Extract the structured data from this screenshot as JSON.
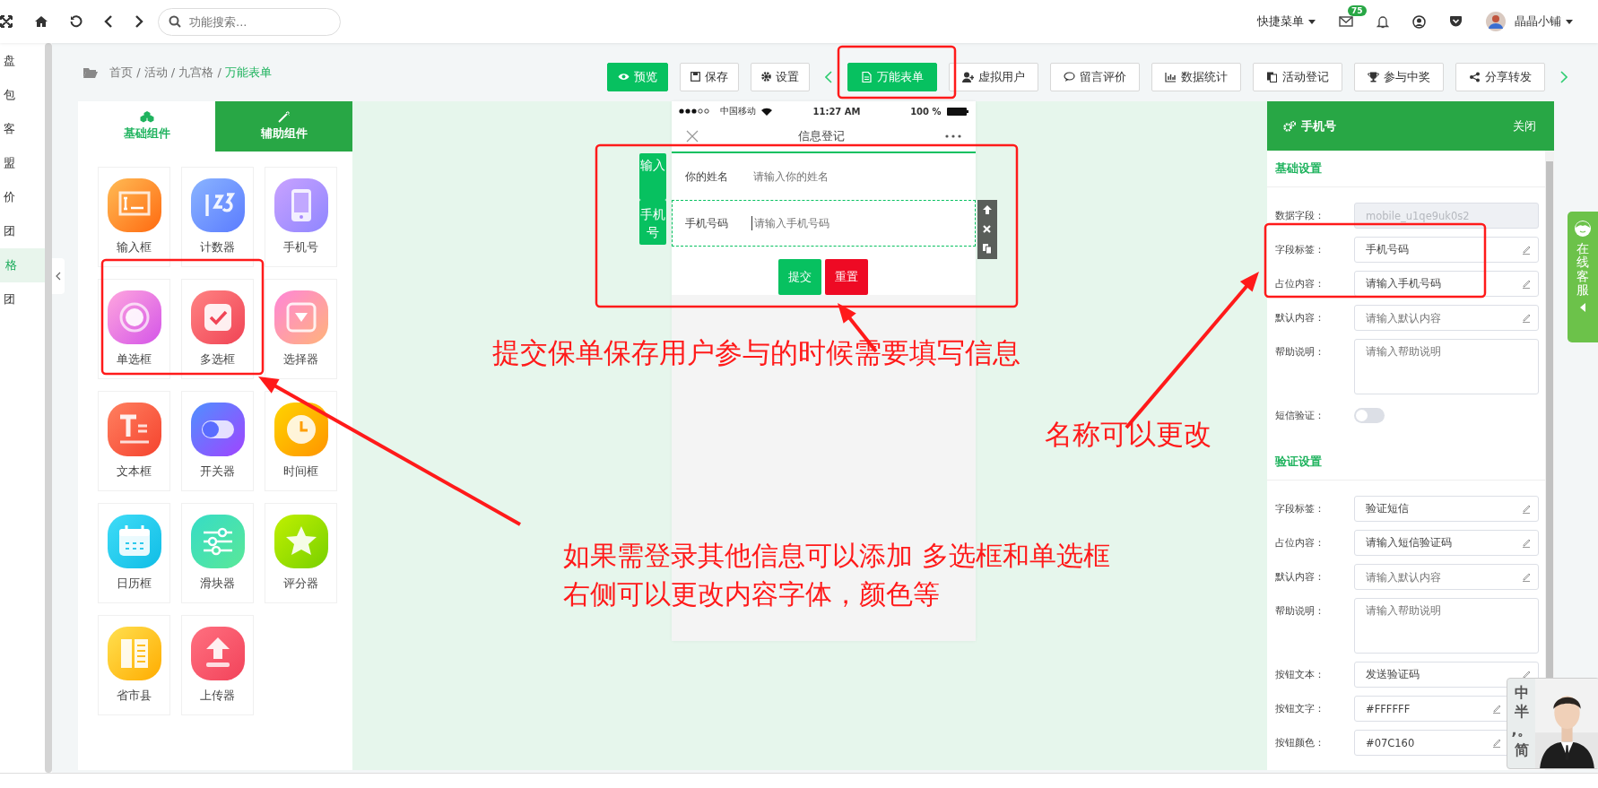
{
  "top_bar": {
    "search": {
      "placeholder": "功能搜索..."
    },
    "quick_menu": "快捷菜单",
    "mail_badge": "75",
    "user_name": "晶晶小铺"
  },
  "sidebar": {
    "items": [
      {
        "label": "盘",
        "selected": false
      },
      {
        "label": "包",
        "selected": false
      },
      {
        "label": "客",
        "selected": false
      },
      {
        "label": "盟",
        "selected": false
      },
      {
        "label": "价",
        "selected": false
      },
      {
        "label": "团",
        "selected": false
      },
      {
        "label": "格",
        "selected": true
      },
      {
        "label": "团",
        "selected": false
      }
    ]
  },
  "breadcrumb": {
    "path": "首页 / 活动 / 九宫格 /",
    "current": "万能表单"
  },
  "toolbar": {
    "preview": "预览",
    "actions": [
      {
        "label": "保存",
        "kind": "save"
      },
      {
        "label": "设置",
        "kind": "settings"
      }
    ],
    "tabs": [
      {
        "label": "万能表单",
        "kind": "form",
        "selected": true
      },
      {
        "label": "虚拟用户",
        "kind": "users",
        "selected": false
      },
      {
        "label": "留言评价",
        "kind": "comment",
        "selected": false
      },
      {
        "label": "数据统计",
        "kind": "chart",
        "selected": false
      },
      {
        "label": "活动登记",
        "kind": "register",
        "selected": false
      },
      {
        "label": "参与中奖",
        "kind": "trophy",
        "selected": false
      },
      {
        "label": "分享转发",
        "kind": "share",
        "selected": false
      }
    ]
  },
  "component_panel": {
    "tabs": [
      {
        "label": "基础组件",
        "selected": true
      },
      {
        "label": "辅助组件",
        "selected": false
      }
    ],
    "items": [
      {
        "label": "输入框",
        "kind": "input"
      },
      {
        "label": "计数器",
        "kind": "counter"
      },
      {
        "label": "手机号",
        "kind": "phone"
      },
      {
        "label": "单选框",
        "kind": "radio"
      },
      {
        "label": "多选框",
        "kind": "checkbox"
      },
      {
        "label": "选择器",
        "kind": "select"
      },
      {
        "label": "文本框",
        "kind": "text"
      },
      {
        "label": "开关器",
        "kind": "switch"
      },
      {
        "label": "时间框",
        "kind": "time"
      },
      {
        "label": "日历框",
        "kind": "calendar"
      },
      {
        "label": "滑块器",
        "kind": "slider"
      },
      {
        "label": "评分器",
        "kind": "rating"
      },
      {
        "label": "省市县",
        "kind": "region"
      },
      {
        "label": "上传器",
        "kind": "upload"
      }
    ]
  },
  "phone": {
    "carrier": "中国移动",
    "time": "11:27 AM",
    "battery": "100 %",
    "title": "信息登记",
    "component_tags": [
      "输入",
      "手机号"
    ],
    "fields": [
      {
        "label": "你的姓名",
        "placeholder": "请输入你的姓名",
        "selected": false
      },
      {
        "label": "手机号码",
        "placeholder": "请输入手机号码",
        "selected": true
      }
    ],
    "buttons": [
      {
        "label": "提交",
        "kind": "submit"
      },
      {
        "label": "重置",
        "kind": "reset"
      }
    ]
  },
  "settings_panel": {
    "title": "手机号",
    "close": "关闭",
    "sections": [
      {
        "title": "基础设置",
        "fields": [
          {
            "label": "数据字段：",
            "kind": "text",
            "value": "mobile_u1qe9uk0s2",
            "disabled": true
          },
          {
            "label": "字段标签：",
            "kind": "text",
            "value": "手机号码",
            "disabled": false
          },
          {
            "label": "占位内容：",
            "kind": "text",
            "value": "请输入手机号码",
            "disabled": false
          },
          {
            "label": "默认内容：",
            "kind": "text",
            "placeholder": "请输入默认内容",
            "disabled": false
          },
          {
            "label": "帮助说明：",
            "kind": "textarea",
            "placeholder": "请输入帮助说明",
            "disabled": false
          },
          {
            "label": "短信验证：",
            "kind": "toggle",
            "on": false
          }
        ]
      },
      {
        "title": "验证设置",
        "fields": [
          {
            "label": "字段标签：",
            "kind": "text",
            "value": "验证短信",
            "disabled": false
          },
          {
            "label": "占位内容：",
            "kind": "text",
            "value": "请输入短信验证码",
            "disabled": false
          },
          {
            "label": "默认内容：",
            "kind": "text",
            "placeholder": "请输入默认内容",
            "disabled": false
          },
          {
            "label": "帮助说明：",
            "kind": "textarea",
            "placeholder": "请输入帮助说明",
            "disabled": false
          },
          {
            "label": "按钮文本：",
            "kind": "text",
            "value": "发送验证码",
            "disabled": false
          },
          {
            "label": "按钮文字：",
            "kind": "color",
            "value": "#FFFFFF",
            "disabled": false
          },
          {
            "label": "按钮颜色：",
            "kind": "color",
            "value": "#07C160",
            "disabled": false
          }
        ]
      }
    ]
  },
  "service_tab": {
    "label": "在线客服"
  },
  "ime_toolbar": {
    "keys": [
      "中",
      "半",
      ",。",
      "简"
    ],
    "kind": "picture"
  },
  "annotations": [
    {
      "text": "提交保单保存用户参与的时候需要填写信息",
      "kind": "form"
    },
    {
      "text": "名称可以更改",
      "kind": "name"
    },
    {
      "text": "如果需登录其他信息可以添加 多选框和单选框",
      "kind": "add1"
    },
    {
      "text": "右侧可以更改内容字体，颜色等",
      "kind": "add2"
    }
  ]
}
